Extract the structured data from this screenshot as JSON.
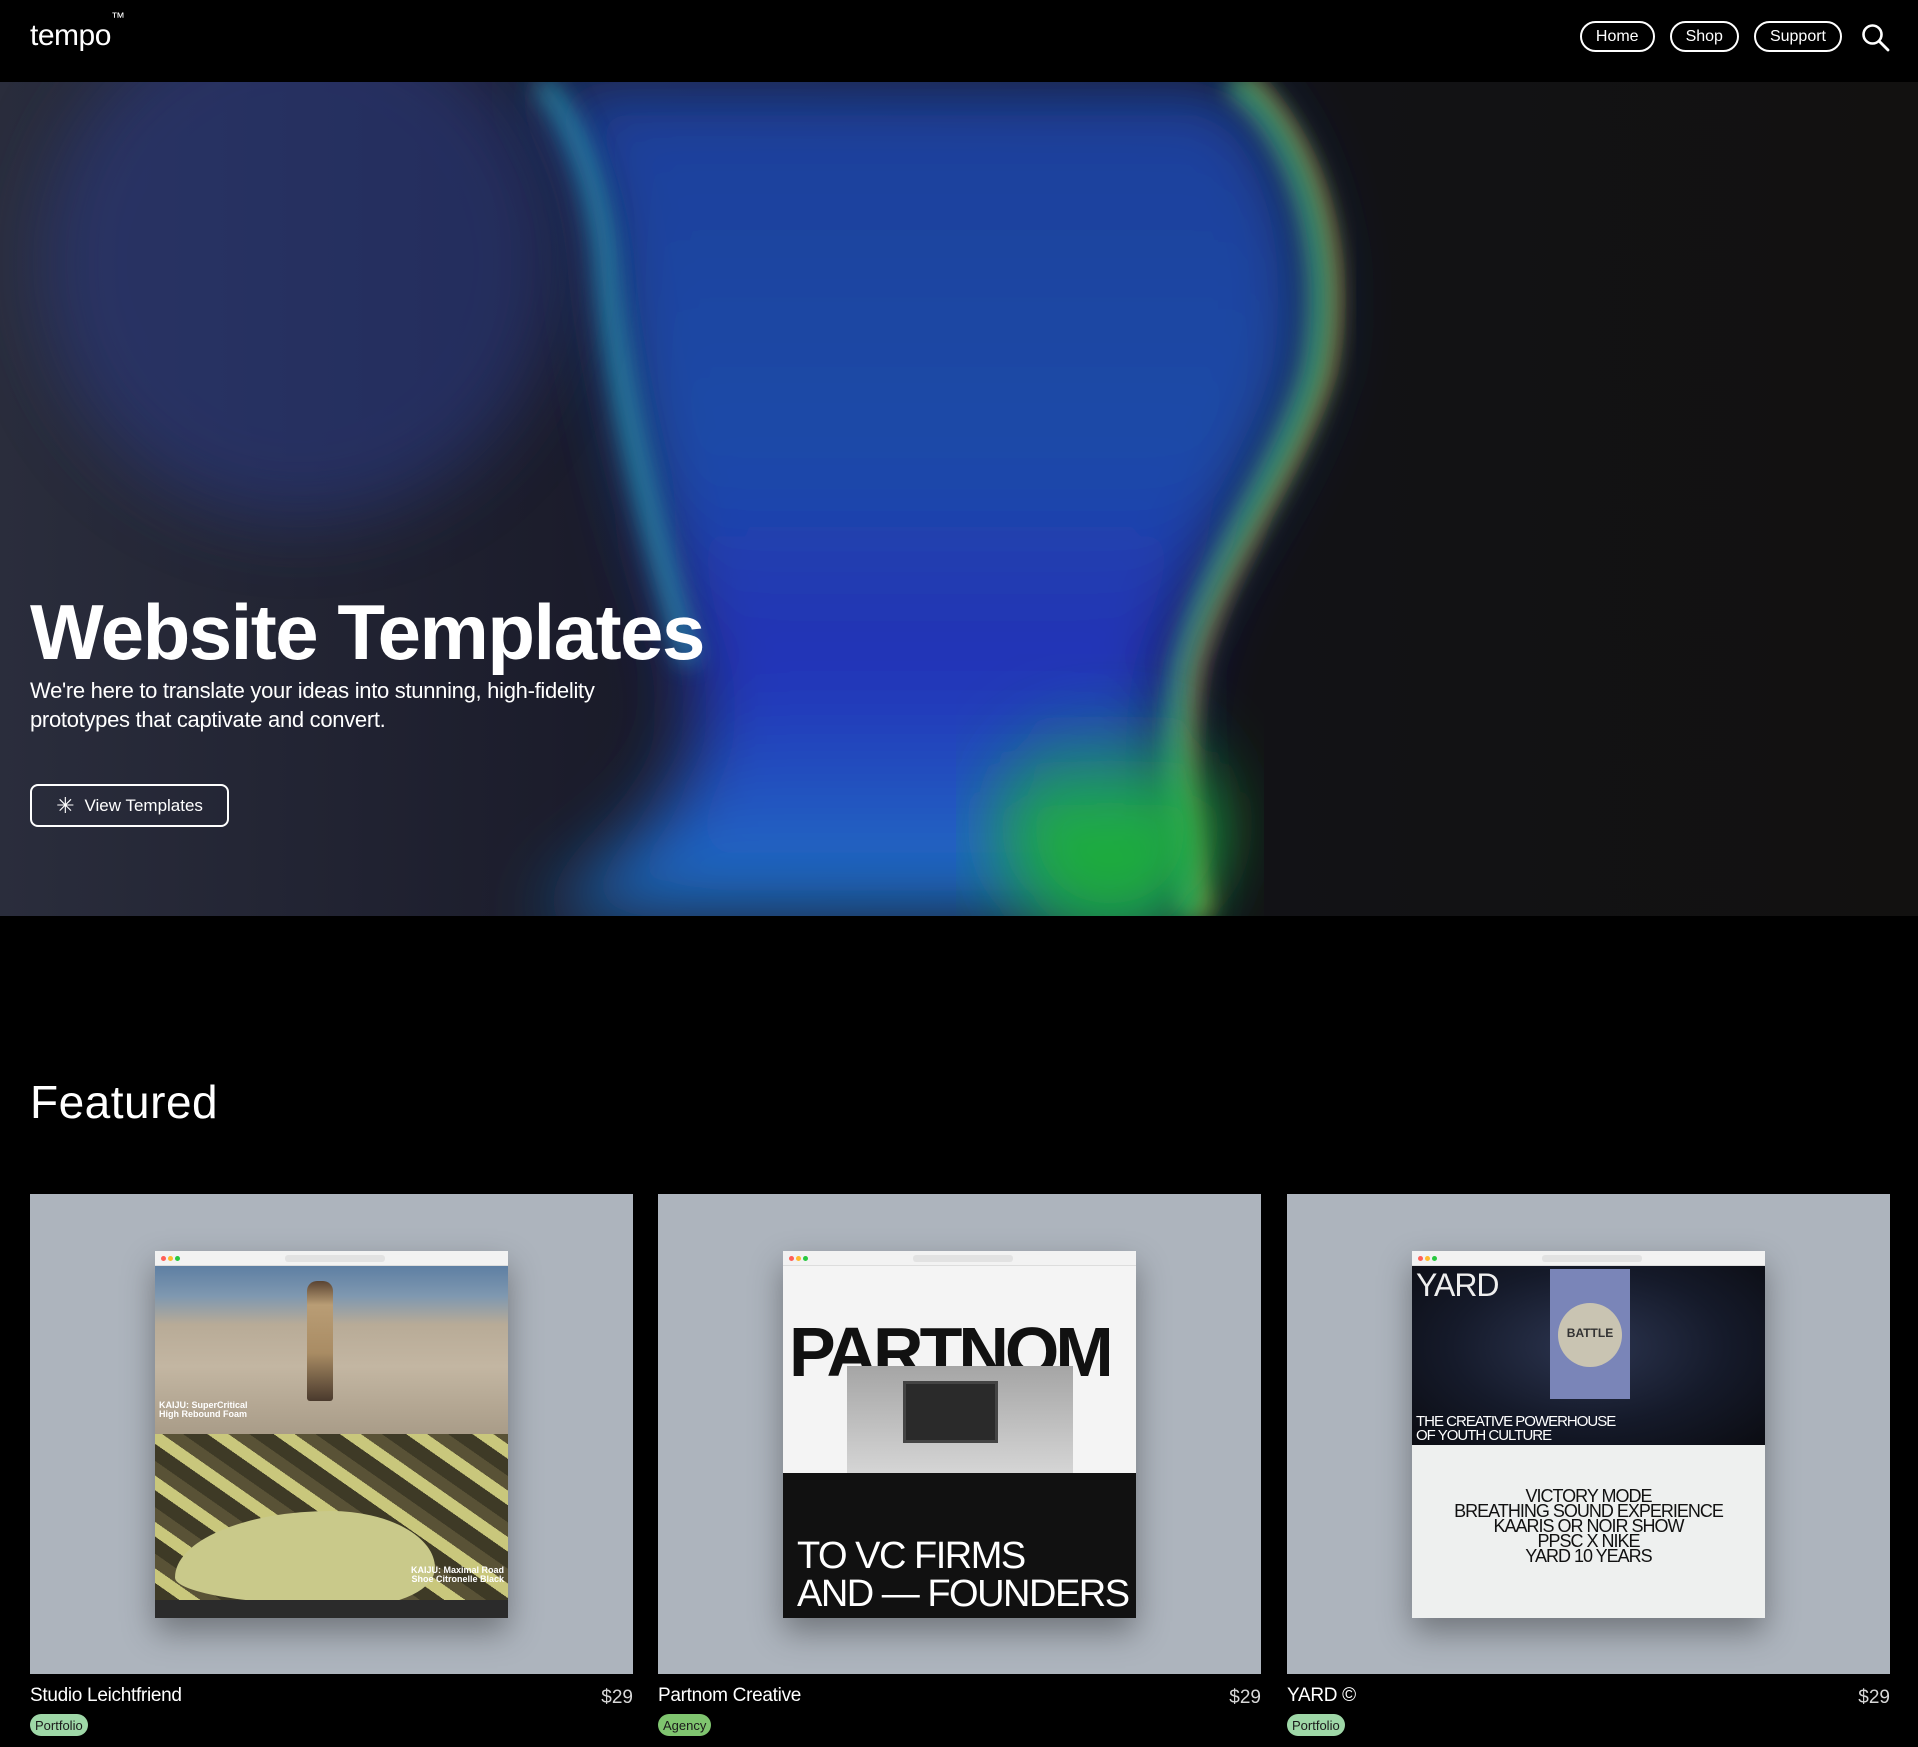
{
  "header": {
    "logo": "tempo",
    "logo_mark": "™",
    "nav": [
      "Home",
      "Shop",
      "Support"
    ],
    "search_icon": "search-icon"
  },
  "hero": {
    "title": "Website Templates",
    "subtitle": "We're here to translate your ideas into stunning, high-fidelity prototypes that captivate and convert.",
    "cta": "View Templates",
    "cta_icon": "asterisk-icon"
  },
  "featured": {
    "title": "Featured",
    "cards": [
      {
        "name": "Studio Leichtfriend",
        "price": "$29",
        "tag": "Portfolio",
        "tag_color": "#9ed7a7",
        "preview": {
          "caption_top": "KAIJU: SuperCritical High Rebound Foam",
          "caption_bottom": "KAIJU: Maximal Road Shoe Citronelle Black"
        }
      },
      {
        "name": "Partnom Creative",
        "price": "$29",
        "tag": "Agency",
        "tag_color": "#7fc46f",
        "preview": {
          "headline": "PARTNOM",
          "line1": "TO VC FIRMS",
          "line2": "AND — FOUNDERS"
        }
      },
      {
        "name": "YARD ©",
        "price": "$29",
        "tag": "Portfolio",
        "tag_color": "#9ed7a7",
        "preview": {
          "logo": "YARD",
          "banner_text": "BATTLE",
          "tagline": "THE CREATIVE POWERHOUSE OF YOUTH CULTURE",
          "list": [
            "VICTORY MODE",
            "BREATHING SOUND EXPERIENCE",
            "KAARIS OR NOIR SHOW",
            "PPSC X NIKE",
            "YARD 10 YEARS"
          ]
        }
      }
    ]
  },
  "colors": {
    "background": "#000000",
    "card_bg": "#adb4bd"
  }
}
